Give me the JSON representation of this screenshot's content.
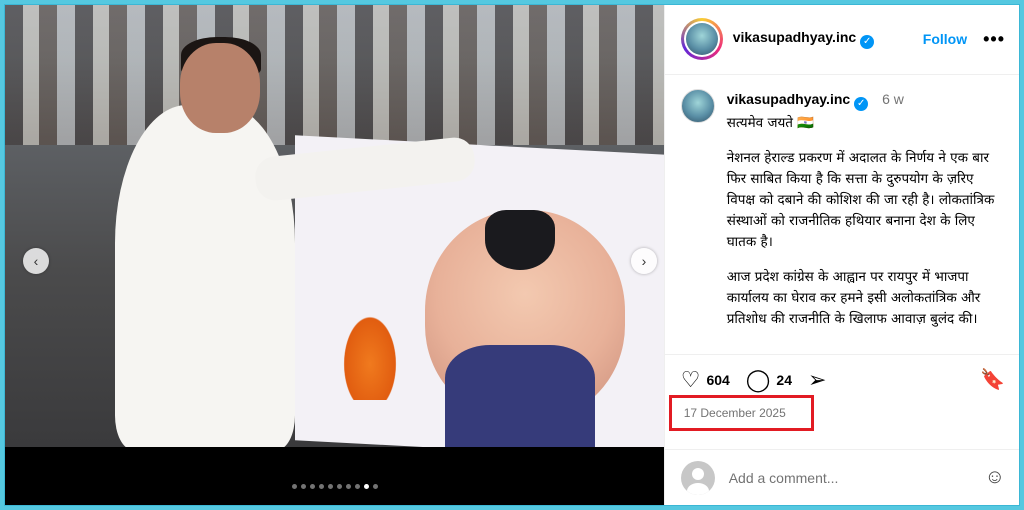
{
  "post": {
    "username": "vikasupadhyay.inc",
    "follow_label": "Follow",
    "more_label": "•••"
  },
  "caption": {
    "username": "vikasupadhyay.inc",
    "time_ago": "6 w",
    "headline": "सत्यमेव जयते 🇮🇳",
    "paragraph1": "नेशनल हेराल्ड प्रकरण में अदालत के निर्णय ने एक बार फिर साबित किया है कि सत्ता के दुरुपयोग के ज़रिए विपक्ष को दबाने की कोशिश की जा रही है। लोकतांत्रिक संस्थाओं को राजनीतिक हथियार बनाना देश के लिए घातक है।",
    "paragraph2": "आज प्रदेश कांग्रेस के आह्वान पर रायपुर में भाजपा कार्यालय का घेराव कर हमने इसी अलोकतांत्रिक और प्रतिशोध की राजनीति के खिलाफ आवाज़ बुलंद की।"
  },
  "actions": {
    "likes": "604",
    "comments": "24"
  },
  "date": "17 December 2025",
  "comment_box": {
    "placeholder": "Add a comment..."
  },
  "carousel": {
    "total_slides": 10,
    "active_slide": 8
  },
  "icons": {
    "verified": "verified-badge-icon",
    "like": "heart-icon",
    "comment": "comment-icon",
    "share": "share-icon",
    "save": "bookmark-icon",
    "emoji": "emoji-icon",
    "prev": "chevron-left-icon",
    "next": "chevron-right-icon"
  },
  "colors": {
    "accent": "#0095f6",
    "highlight_box": "#e21b23",
    "frame": "#55c8e0"
  }
}
